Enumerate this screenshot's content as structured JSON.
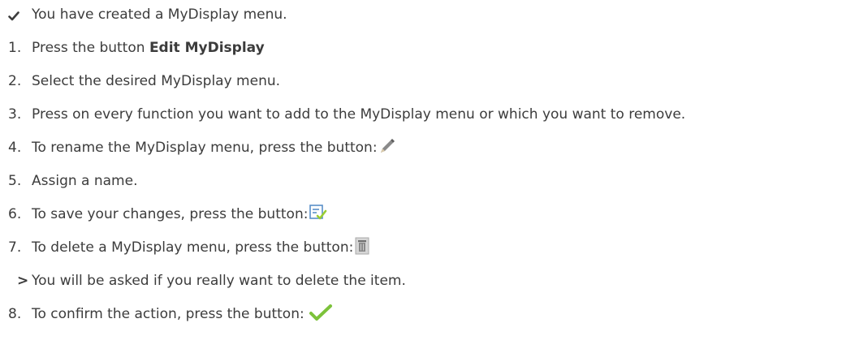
{
  "prerequisite": {
    "text": "You have created a MyDisplay menu."
  },
  "steps": [
    {
      "number": "1.",
      "text": "Press the button ",
      "bold": "Edit MyDisplay"
    },
    {
      "number": "2.",
      "text": "Select the desired MyDisplay menu."
    },
    {
      "number": "3.",
      "text": "Press on every function you want to add to the MyDisplay menu or which you want to remove."
    },
    {
      "number": "4.",
      "text": "To rename the MyDisplay menu, press the button:",
      "icon": "pencil-icon"
    },
    {
      "number": "5.",
      "text": "Assign a name."
    },
    {
      "number": "6.",
      "text": "To save your changes, press the button:",
      "icon": "save-check-icon"
    },
    {
      "number": "7.",
      "text": "To delete a MyDisplay menu, press the button:",
      "icon": "trash-icon"
    },
    {
      "number": "8.",
      "text": "To confirm the action, press the button: ",
      "icon": "green-check-icon"
    }
  ],
  "result": {
    "marker": ">",
    "text": "You will be asked if you really want to delete the item."
  },
  "colors": {
    "text": "#3c3c3c",
    "check_green": "#7cc23a",
    "save_icon_blue": "#5a8fc8"
  }
}
